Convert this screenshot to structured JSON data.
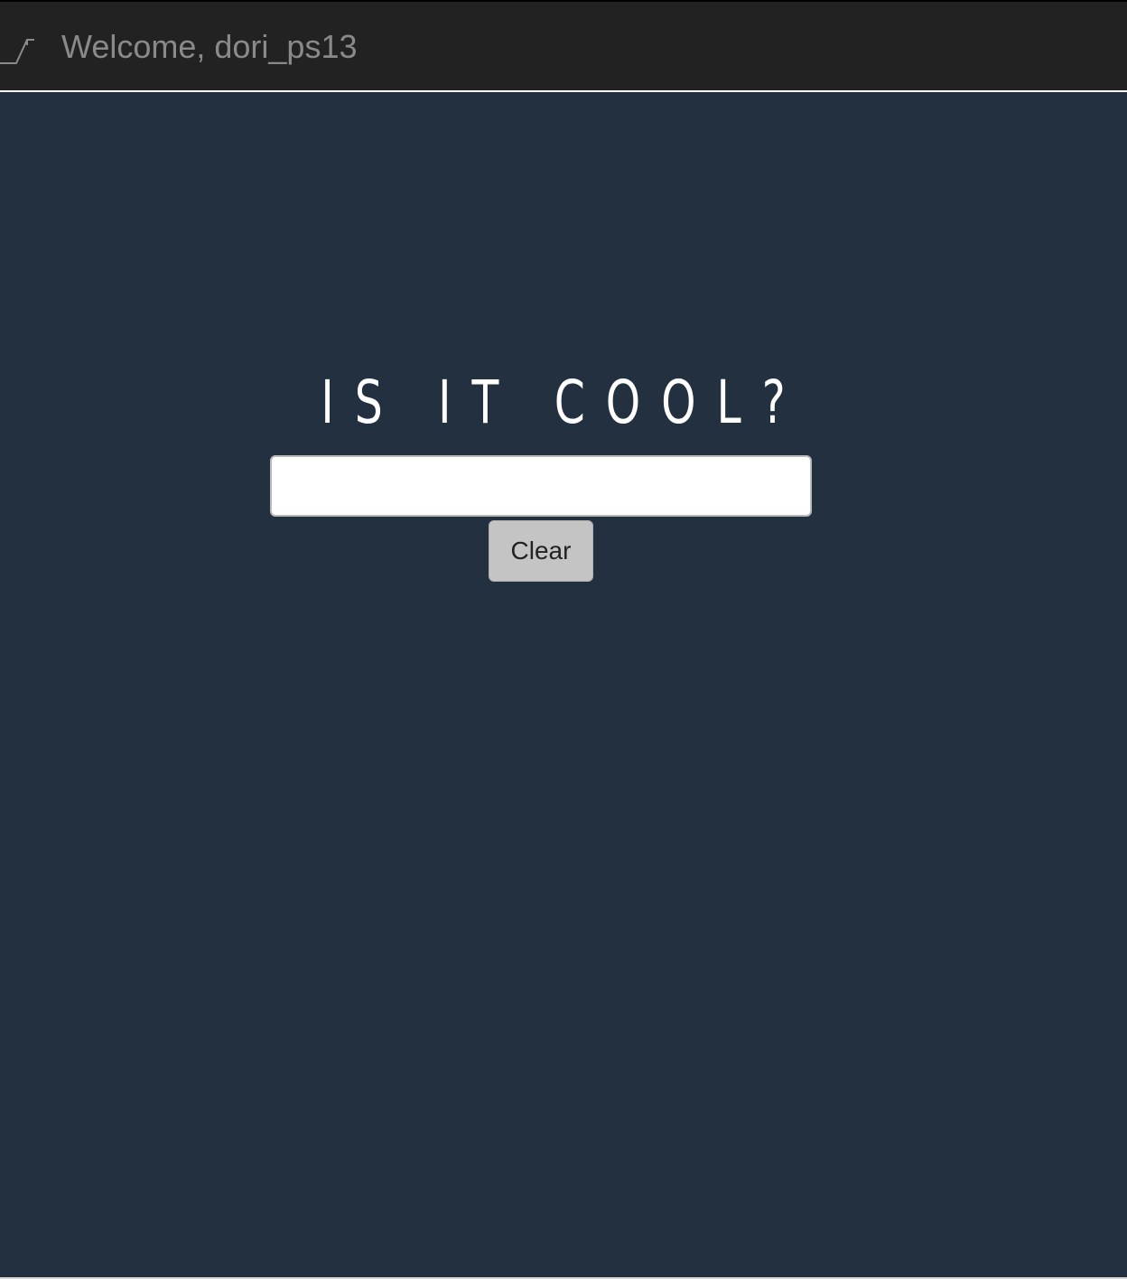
{
  "header": {
    "logo_icon": "logo-icon",
    "welcome_text": "Welcome, dori_ps13"
  },
  "main": {
    "title": "IS IT COOL?",
    "search": {
      "value": "",
      "placeholder": ""
    },
    "clear_label": "Clear"
  },
  "colors": {
    "navbar_background": "#222222",
    "page_background": "#223040",
    "title_text": "#ffffff",
    "welcome_text": "#8a8a8a",
    "button_background": "#c4c4c4"
  }
}
